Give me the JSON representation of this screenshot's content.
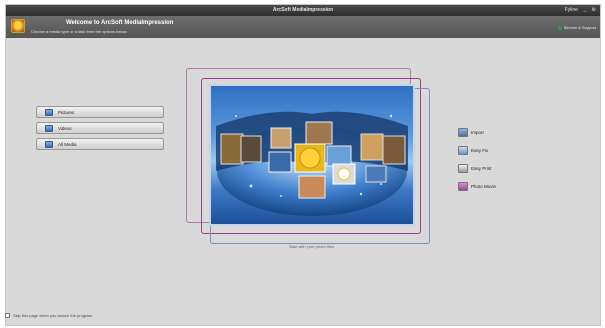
{
  "window": {
    "title": "ArcSoft MediaImpression"
  },
  "controls": {
    "minimize": "_",
    "settings": "⚙",
    "account": "Fyline"
  },
  "header": {
    "welcome_title": "Welcome to ArcSoft MediaImpression",
    "welcome_subtitle": "Choose a media type or a task from the options below.",
    "help_label": "Service & Support"
  },
  "left_menu": [
    {
      "label": "Pictures",
      "icon": "pictures-icon",
      "color": "#4f8fd6"
    },
    {
      "label": "Videos",
      "icon": "videos-icon",
      "color": "#3a7ac4"
    },
    {
      "label": "All Media",
      "icon": "all-media-icon",
      "color": "#2e6bb5"
    }
  ],
  "right_tasks": [
    {
      "label": "Import",
      "icon": "import-icon",
      "color": "#4b6fa8"
    },
    {
      "label": "Easy Fix",
      "icon": "easy-fix-icon",
      "color": "#6a8fc8"
    },
    {
      "label": "Easy Print",
      "icon": "easy-print-icon",
      "color": "#7a7a7a"
    },
    {
      "label": "Photo Movie",
      "icon": "photo-movie-icon",
      "color": "#9a4a9a"
    }
  ],
  "preview": {
    "caption": "Start with your photo files."
  },
  "footer": {
    "checkbox_label": "Skip this page when you launch the program"
  },
  "colors": {
    "header_bg": "#5f5f5f",
    "window_bg": "#d9d9d9",
    "accent_frame": "#9a3d8d"
  }
}
